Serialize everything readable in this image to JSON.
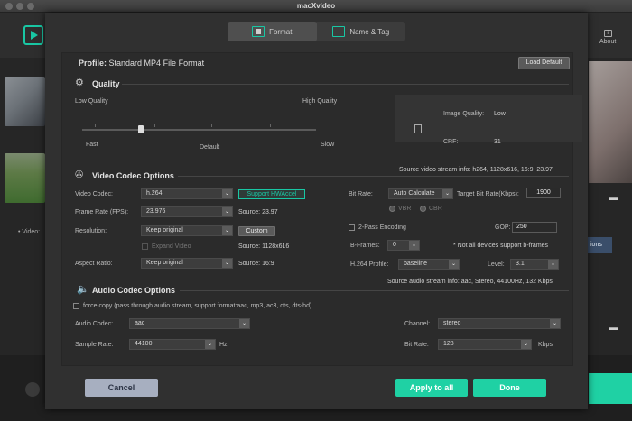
{
  "window": {
    "title": "macXvideo"
  },
  "background": {
    "about_label": "About",
    "about_icon": "info-icon",
    "video_label": "Video:",
    "options_label": "ions"
  },
  "tabs": [
    {
      "label": "Format",
      "active": true
    },
    {
      "label": "Name & Tag",
      "active": false
    }
  ],
  "profile": {
    "prefix": "Profile:",
    "name": "Standard MP4 File Format"
  },
  "load_default_label": "Load Default",
  "quality": {
    "title": "Quality",
    "low_label": "Low Quality",
    "high_label": "High Quality",
    "fast_label": "Fast",
    "default_label": "Default",
    "slow_label": "Slow",
    "image_quality_label": "Image Quality:",
    "image_quality_value": "Low",
    "crf_label": "CRF:",
    "crf_value": "31",
    "slider_level": 0.25
  },
  "video": {
    "title": "Video Codec Options",
    "source_info": "Source video stream info: h264, 1128x616, 16:9, 23.97",
    "codec_label": "Video Codec:",
    "codec_value": "h.264",
    "hw_label": "Support HWAccel",
    "framerate_label": "Frame Rate (FPS):",
    "framerate_value": "23.976",
    "framerate_source": "Source: 23.97",
    "resolution_label": "Resolution:",
    "resolution_value": "Keep original",
    "custom_label": "Custom",
    "expand_label": "Expand Video",
    "resolution_source": "Source: 1128x616",
    "aspect_label": "Aspect Ratio:",
    "aspect_value": "Keep original",
    "aspect_source": "Source: 16:9",
    "bitrate_label": "Bit Rate:",
    "bitrate_mode": "Auto Calculate",
    "target_bitrate_label": "Target Bit Rate(Kbps):",
    "target_bitrate_value": "1900",
    "vbr_label": "VBR",
    "cbr_label": "CBR",
    "twopass_label": "2-Pass Encoding",
    "gop_label": "GOP:",
    "gop_value": "250",
    "bframes_label": "B-Frames:",
    "bframes_value": "0",
    "bframes_note": "* Not all devices support b-frames",
    "h264_profile_label": "H.264 Profile:",
    "h264_profile_value": "baseline",
    "level_label": "Level:",
    "level_value": "3.1"
  },
  "audio": {
    "title": "Audio Codec Options",
    "source_info": "Source audio stream info: aac, Stereo, 44100Hz, 132 Kbps",
    "force_copy_label": "force copy (pass through audio stream, support format:aac, mp3, ac3, dts, dts-hd)",
    "codec_label": "Audio Codec:",
    "codec_value": "aac",
    "channel_label": "Channel:",
    "channel_value": "stereo",
    "samplerate_label": "Sample Rate:",
    "samplerate_value": "44100",
    "samplerate_unit": "Hz",
    "bitrate_label": "Bit Rate:",
    "bitrate_value": "128",
    "bitrate_unit": "Kbps"
  },
  "footer": {
    "cancel_label": "Cancel",
    "apply_all_label": "Apply to all",
    "done_label": "Done"
  }
}
